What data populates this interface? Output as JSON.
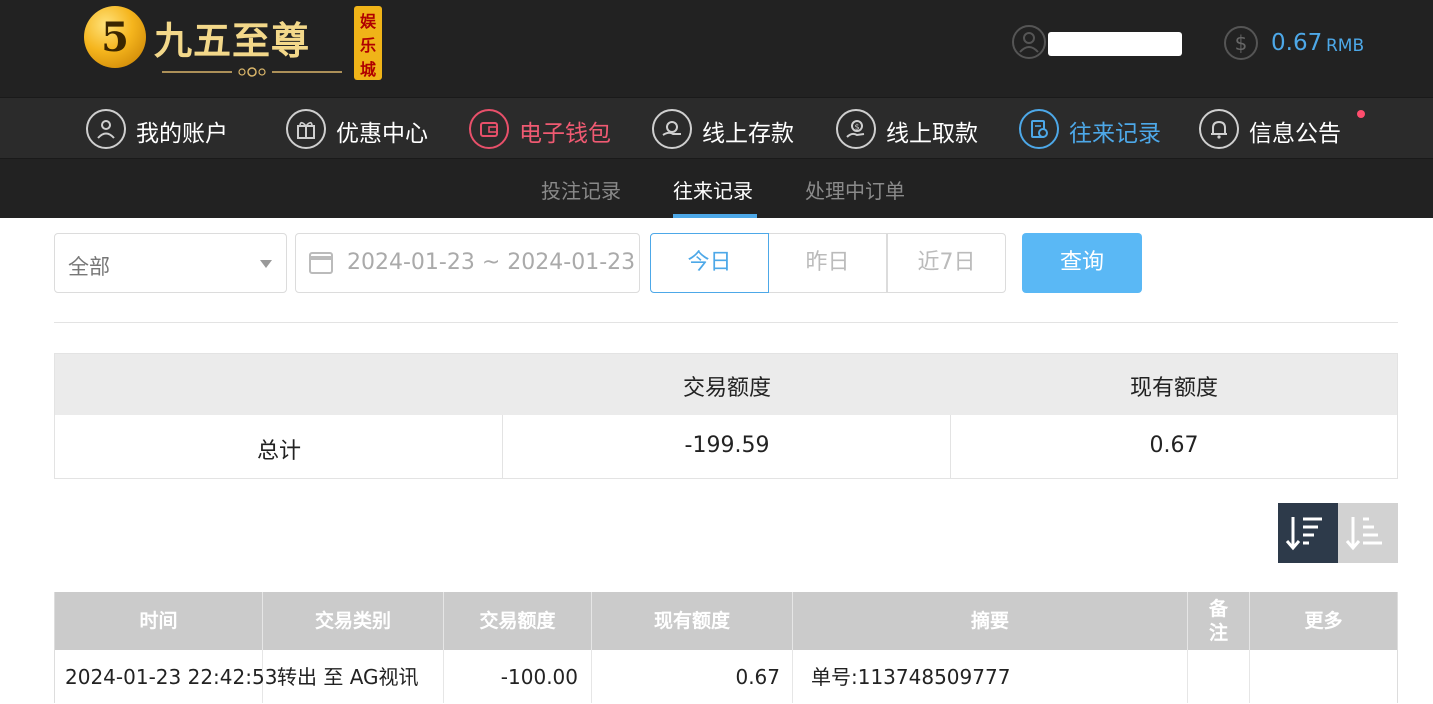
{
  "header": {
    "logo_text": "九五至尊",
    "logo_badge": [
      "娱",
      "乐",
      "城"
    ],
    "logo_number": "5",
    "balance_value": "0.67",
    "balance_unit": "RMB"
  },
  "main_nav": [
    {
      "label": "我的账户",
      "icon": "user-circle-icon",
      "state": "normal"
    },
    {
      "label": "优惠中心",
      "icon": "gift-icon",
      "state": "normal"
    },
    {
      "label": "电子钱包",
      "icon": "wallet-icon",
      "state": "highlight-red"
    },
    {
      "label": "线上存款",
      "icon": "deposit-icon",
      "state": "normal"
    },
    {
      "label": "线上取款",
      "icon": "withdraw-icon",
      "state": "normal"
    },
    {
      "label": "往来记录",
      "icon": "records-icon",
      "state": "active"
    },
    {
      "label": "信息公告",
      "icon": "bell-icon",
      "state": "normal"
    }
  ],
  "sub_nav": [
    {
      "label": "投注记录",
      "active": false
    },
    {
      "label": "往来记录",
      "active": true
    },
    {
      "label": "处理中订单",
      "active": false
    }
  ],
  "filters": {
    "type_select": "全部",
    "date_range": "2024-01-23 ~ 2024-01-23",
    "quick_ranges": [
      "今日",
      "昨日",
      "近7日"
    ],
    "quick_selected": "今日",
    "query_button": "查询"
  },
  "summary": {
    "headers": [
      "",
      "交易额度",
      "现有额度"
    ],
    "row": [
      "总计",
      "-199.59",
      "0.67"
    ]
  },
  "records": {
    "headers": [
      "时间",
      "交易类别",
      "交易额度",
      "现有额度",
      "摘要",
      "备注",
      "更多"
    ],
    "rows": [
      [
        "2024-01-23 22:42:53",
        "转出 至 AG视讯",
        "-100.00",
        "0.67",
        "单号:113748509777",
        "",
        ""
      ]
    ]
  },
  "colors": {
    "accent_blue": "#4da8e8",
    "highlight_red": "#f05a72",
    "header_bg": "#222222",
    "query_button_bg": "#5ab8f5"
  }
}
